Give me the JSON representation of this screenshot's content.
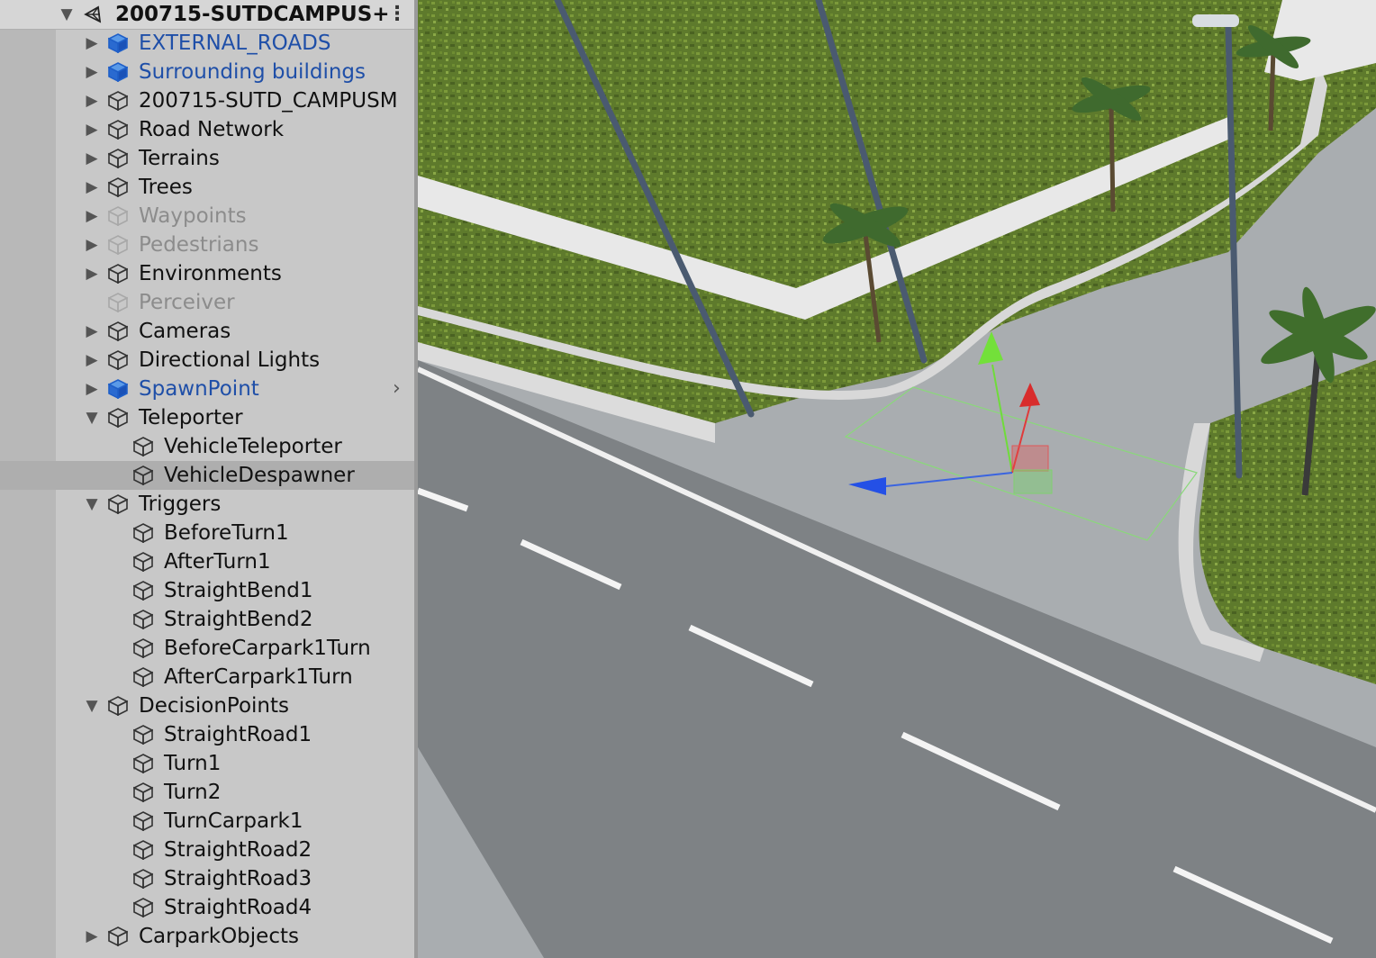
{
  "scene": {
    "name": "200715-SUTDCAMPUS+"
  },
  "colors": {
    "panel_bg": "#c8c8c8",
    "selected_row": "#aeaeae",
    "prefab_blue": "#1f4fa8",
    "inactive_gray": "#8c8c8c"
  },
  "hierarchy": [
    {
      "label": "EXTERNAL_ROADS",
      "icon": "prefab-cube-icon",
      "state": "prefab",
      "expand": "collapsed"
    },
    {
      "label": "Surrounding buildings",
      "icon": "prefab-cube-icon",
      "state": "prefab",
      "expand": "collapsed"
    },
    {
      "label": "200715-SUTD_CAMPUSM",
      "icon": "gameobject-cube-icon",
      "state": "normal",
      "expand": "collapsed"
    },
    {
      "label": "Road Network",
      "icon": "gameobject-cube-icon",
      "state": "normal",
      "expand": "collapsed"
    },
    {
      "label": "Terrains",
      "icon": "gameobject-cube-icon",
      "state": "normal",
      "expand": "collapsed"
    },
    {
      "label": "Trees",
      "icon": "gameobject-cube-icon",
      "state": "normal",
      "expand": "collapsed"
    },
    {
      "label": "Waypoints",
      "icon": "gameobject-cube-icon",
      "state": "inactive",
      "expand": "collapsed"
    },
    {
      "label": "Pedestrians",
      "icon": "gameobject-cube-icon",
      "state": "inactive",
      "expand": "collapsed"
    },
    {
      "label": "Environments",
      "icon": "gameobject-cube-icon",
      "state": "normal",
      "expand": "collapsed"
    },
    {
      "label": "Perceiver",
      "icon": "gameobject-cube-icon",
      "state": "inactive",
      "expand": "none"
    },
    {
      "label": "Cameras",
      "icon": "gameobject-cube-icon",
      "state": "normal",
      "expand": "collapsed"
    },
    {
      "label": "Directional Lights",
      "icon": "gameobject-cube-icon",
      "state": "normal",
      "expand": "collapsed"
    },
    {
      "label": "SpawnPoint",
      "icon": "prefab-cube-icon",
      "state": "prefab",
      "expand": "collapsed",
      "chevron": true
    },
    {
      "label": "Teleporter",
      "icon": "gameobject-cube-icon",
      "state": "normal",
      "expand": "expanded"
    },
    {
      "label": "VehicleTeleporter",
      "icon": "gameobject-cube-icon",
      "state": "normal",
      "expand": "none",
      "child": true
    },
    {
      "label": "VehicleDespawner",
      "icon": "gameobject-cube-icon",
      "state": "normal",
      "expand": "none",
      "child": true,
      "selected": true
    },
    {
      "label": "Triggers",
      "icon": "gameobject-cube-icon",
      "state": "normal",
      "expand": "expanded"
    },
    {
      "label": "BeforeTurn1",
      "icon": "gameobject-cube-icon",
      "state": "normal",
      "expand": "none",
      "child": true
    },
    {
      "label": "AfterTurn1",
      "icon": "gameobject-cube-icon",
      "state": "normal",
      "expand": "none",
      "child": true
    },
    {
      "label": "StraightBend1",
      "icon": "gameobject-cube-icon",
      "state": "normal",
      "expand": "none",
      "child": true
    },
    {
      "label": "StraightBend2",
      "icon": "gameobject-cube-icon",
      "state": "normal",
      "expand": "none",
      "child": true
    },
    {
      "label": "BeforeCarpark1Turn",
      "icon": "gameobject-cube-icon",
      "state": "normal",
      "expand": "none",
      "child": true
    },
    {
      "label": "AfterCarpark1Turn",
      "icon": "gameobject-cube-icon",
      "state": "normal",
      "expand": "none",
      "child": true
    },
    {
      "label": "DecisionPoints",
      "icon": "gameobject-cube-icon",
      "state": "normal",
      "expand": "expanded"
    },
    {
      "label": "StraightRoad1",
      "icon": "gameobject-cube-icon",
      "state": "normal",
      "expand": "none",
      "child": true
    },
    {
      "label": "Turn1",
      "icon": "gameobject-cube-icon",
      "state": "normal",
      "expand": "none",
      "child": true
    },
    {
      "label": "Turn2",
      "icon": "gameobject-cube-icon",
      "state": "normal",
      "expand": "none",
      "child": true
    },
    {
      "label": "TurnCarpark1",
      "icon": "gameobject-cube-icon",
      "state": "normal",
      "expand": "none",
      "child": true
    },
    {
      "label": "StraightRoad2",
      "icon": "gameobject-cube-icon",
      "state": "normal",
      "expand": "none",
      "child": true
    },
    {
      "label": "StraightRoad3",
      "icon": "gameobject-cube-icon",
      "state": "normal",
      "expand": "none",
      "child": true
    },
    {
      "label": "StraightRoad4",
      "icon": "gameobject-cube-icon",
      "state": "normal",
      "expand": "none",
      "child": true
    },
    {
      "label": "CarparkObjects",
      "icon": "gameobject-cube-icon",
      "state": "normal",
      "expand": "collapsed"
    }
  ]
}
